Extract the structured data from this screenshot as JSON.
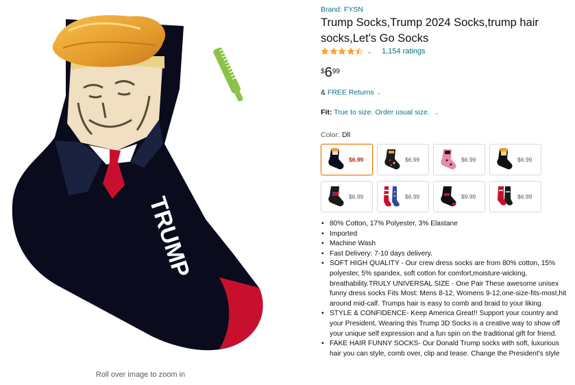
{
  "image": {
    "alt": "Black sock with Trump face and fake orange hair, red tie, TRUMP lettering, and a green comb",
    "zoom_caption": "Roll over image to zoom in"
  },
  "product": {
    "brand": "Brand: FYSN",
    "title": "Trump Socks,Trump 2024 Socks,trump hair socks,Let's Go Socks",
    "rating_stars": 4.5,
    "ratings_count": "1,154 ratings",
    "price": {
      "symbol": "$",
      "whole": "6",
      "fraction": "99"
    },
    "returns": {
      "prefix": "& ",
      "link": "FREE Returns"
    },
    "fit": {
      "label": "Fit:",
      "value": "True to size. Order usual size."
    },
    "color": {
      "label": "Color:",
      "value": "Dll"
    }
  },
  "swatches": [
    {
      "price": "$6.99",
      "selected": true
    },
    {
      "price": "$6.99",
      "selected": false
    },
    {
      "price": "$6.99",
      "selected": false
    },
    {
      "price": "$6.99",
      "selected": false
    },
    {
      "price": "$6.99",
      "selected": false
    },
    {
      "price": "$6.99",
      "selected": false
    },
    {
      "price": "$9.99",
      "selected": false
    },
    {
      "price": "$6.99",
      "selected": false
    }
  ],
  "bullets": [
    "80% Cotton, 17% Polyester, 3% Elastane",
    "Imported",
    "Machine Wash",
    "Fast Delivery: 7-10 days delivery.",
    "SOFT HIGH QUALITY - Our crew dress socks are from 80% cotton, 15% polyester, 5% spandex, soft cotton for comfort,moisture-wicking, breathability.TRULY UNIVERSAL SIZE - One Pair These awesome unisex funny dress socks Fits Most: Mens 8-12, Womens 9-12,one-size-fits-most,hit around mid-calf. Trumps hair is easy to comb and braid to your liking.",
    "STYLE & CONFIDENCE- Keep America Great!! Support your country and your President, Wearing this Trump 3D Socks is a creative way to show off your unique self expression and a fun spin on the traditional gift for friend.",
    "FAKE HAIR FUNNY SOCKS- Our Donald Trump socks with soft, luxurious hair you can style, comb over, clip and tease. Change the President's style"
  ],
  "colors": {
    "link": "#007185",
    "star": "#ffa41c",
    "price_red": "#b12704",
    "selected_border": "#e77600",
    "sock_black": "#0b0b1e",
    "sock_red": "#c8102e",
    "hair_orange": "#e8a13a",
    "comb_green": "#8bc34a"
  },
  "icons": {
    "star": "star-icon",
    "chevron": "chevron-down-icon"
  }
}
